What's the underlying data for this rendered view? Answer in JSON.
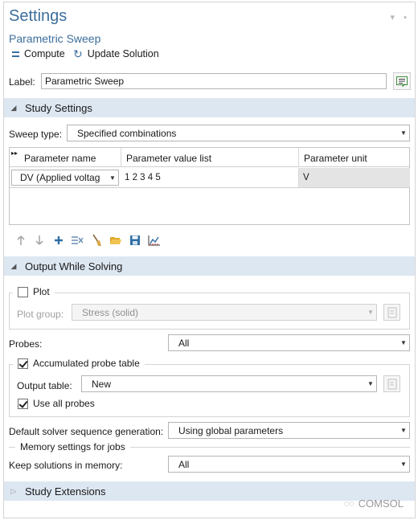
{
  "header": {
    "title": "Settings",
    "subtitle": "Parametric Sweep"
  },
  "toolbar": {
    "compute_label": "Compute",
    "update_label": "Update Solution"
  },
  "label_field": {
    "label": "Label:",
    "value": "Parametric Sweep"
  },
  "study_settings": {
    "section_title": "Study Settings",
    "sweep_type_label": "Sweep type:",
    "sweep_type_value": "Specified combinations",
    "table": {
      "columns": [
        "Parameter name",
        "Parameter value list",
        "Parameter unit"
      ],
      "rows": [
        {
          "name": "DV (Applied voltag",
          "values": "1 2 3 4 5",
          "unit": "V"
        }
      ]
    }
  },
  "output": {
    "section_title": "Output While Solving",
    "plot_label": "Plot",
    "plot_checked": false,
    "plot_group_label": "Plot group:",
    "plot_group_value": "Stress (solid)",
    "probes_label": "Probes:",
    "probes_value": "All",
    "accumulated_label": "Accumulated probe table",
    "accumulated_checked": true,
    "output_table_label": "Output table:",
    "output_table_value": "New",
    "use_all_probes_label": "Use all probes",
    "use_all_probes_checked": true,
    "default_solver_label": "Default solver sequence generation:",
    "default_solver_value": "Using global parameters",
    "memory_title": "Memory settings for jobs",
    "keep_label": "Keep solutions in memory:",
    "keep_value": "All"
  },
  "extensions": {
    "section_title": "Study Extensions"
  },
  "watermark": {
    "text": "COMSOL"
  },
  "colors": {
    "accent": "#3c6e9c",
    "section_bg": "#dde7f2"
  }
}
